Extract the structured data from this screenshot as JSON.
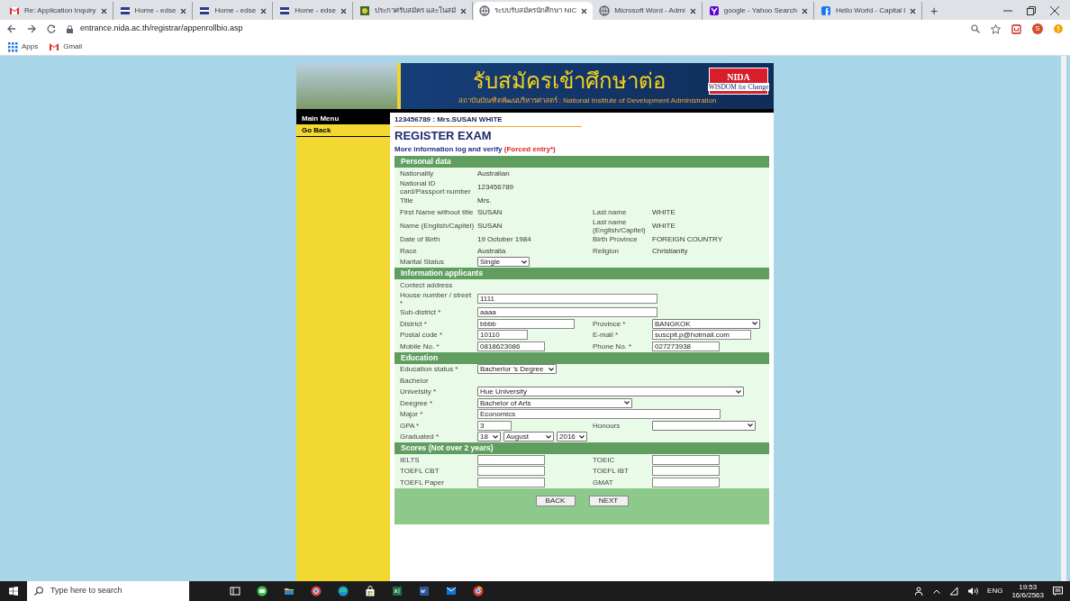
{
  "browser": {
    "tabs": [
      {
        "title": "Re: Application Inquiry",
        "kind": "mail",
        "selected": false
      },
      {
        "title": "Home - edse",
        "kind": "flag",
        "selected": false
      },
      {
        "title": "Home - edse",
        "kind": "flag",
        "selected": false
      },
      {
        "title": "Home - edse",
        "kind": "flag",
        "selected": false
      },
      {
        "title": "ประกาศรับสมัคร และในสมั",
        "kind": "photo",
        "selected": false
      },
      {
        "title": "ระบบรับสมัครนักศึกษา NIC",
        "kind": "globe",
        "selected": true
      },
      {
        "title": "Microsoft Word - Admi",
        "kind": "globe",
        "selected": false
      },
      {
        "title": "google - Yahoo Search",
        "kind": "yahoo",
        "selected": false
      },
      {
        "title": "Hello World - Capital l",
        "kind": "facebook",
        "selected": false
      }
    ],
    "new_tab": "+",
    "url": "entrance.nida.ac.th/registrar/appenrollbio.asp",
    "profile_initial": "S",
    "bookmarks": [
      {
        "label": "Apps",
        "kind": "grid"
      },
      {
        "label": "Gmail",
        "kind": "mail"
      }
    ]
  },
  "page": {
    "banner": {
      "title": "รับสมัครเข้าศึกษาต่อ",
      "subtitle": "สถาบันบัณฑิตพัฒนบริหารศาสตร์ : National Institute of Development Administration",
      "logo": "NIDA",
      "logo_tagline": "WISDOM for Change"
    },
    "sidebar": [
      {
        "label": "Main Menu",
        "kind": "heading"
      },
      {
        "label": "Go Back",
        "kind": "link"
      }
    ],
    "user_line": "123456789 : Mrs.SUSAN WHITE",
    "heading": "REGISTER EXAM",
    "intro": {
      "text": "More information log and verify",
      "note": "(Forced entry*)"
    },
    "sections": [
      {
        "title": "Personal data",
        "rows": [
          [
            {
              "label": "Nationality",
              "kind": "text",
              "value": "Australian"
            }
          ],
          [
            {
              "label": "National ID card/Passport number",
              "kind": "text",
              "value": "123456789"
            }
          ],
          [
            {
              "label": "Title",
              "kind": "text",
              "value": "Mrs."
            }
          ],
          [
            {
              "label": "First Name without title",
              "kind": "text",
              "value": "SUSAN"
            },
            {
              "label": "Last name",
              "kind": "text",
              "value": "WHITE"
            }
          ],
          [
            {
              "label": "Name (English/Capitel)",
              "kind": "text",
              "value": "SUSAN"
            },
            {
              "label": "Last name (English/Capitel)",
              "kind": "text",
              "value": "WHITE"
            }
          ],
          [
            {
              "label": "Date of Birth",
              "kind": "text",
              "value": "19 October 1984"
            },
            {
              "label": "Birth Province",
              "kind": "text",
              "value": "FOREIGN COUNTRY"
            }
          ],
          [
            {
              "label": "Race",
              "kind": "text",
              "value": "Australia"
            },
            {
              "label": "Religion",
              "kind": "text",
              "value": "Christianity"
            }
          ],
          [
            {
              "label": "Marital Status",
              "kind": "select",
              "value": "Single"
            }
          ]
        ]
      },
      {
        "title": "Information applicants",
        "rows": [
          [
            {
              "label": "Contect address",
              "kind": "note"
            }
          ],
          [
            {
              "label": "House number / street *",
              "kind": "input",
              "value": "1111"
            }
          ],
          [
            {
              "label": "Sub-district *",
              "kind": "input",
              "value": "aaaa"
            }
          ],
          [
            {
              "label": "District *",
              "kind": "input",
              "value": "bbbb"
            },
            {
              "label": "Province *",
              "kind": "select",
              "value": "BANGKOK"
            }
          ],
          [
            {
              "label": "Postal code *",
              "kind": "input",
              "value": "10110"
            },
            {
              "label": "E-mail *",
              "kind": "input",
              "value": "suscpit.p@hotmail.com"
            }
          ],
          [
            {
              "label": "Mobile No. *",
              "kind": "input",
              "value": "0818623086"
            },
            {
              "label": "Phone No. *",
              "kind": "input",
              "value": "027273938"
            }
          ]
        ]
      },
      {
        "title": "Education",
        "rows": [
          [
            {
              "label": "Education status *",
              "kind": "select",
              "value": "Bacherlor 's Degree"
            }
          ],
          [
            {
              "label": "Bachelor",
              "kind": "note"
            }
          ],
          [
            {
              "label": "Univetsity *",
              "kind": "select",
              "value": "Hue University"
            }
          ],
          [
            {
              "label": "Deegree *",
              "kind": "select",
              "value": "Bachelor of Arts"
            }
          ],
          [
            {
              "label": "Major *",
              "kind": "input",
              "value": "Economics"
            }
          ],
          [
            {
              "label": "GPA *",
              "kind": "input",
              "value": "3"
            },
            {
              "label": "Honours",
              "kind": "select"
            }
          ],
          [
            {
              "label": "Graduated *",
              "kind": "dates",
              "values": [
                "18",
                "August",
                "2016"
              ]
            }
          ]
        ]
      },
      {
        "title": "Scores (Not over 2 years)",
        "rows": [
          [
            {
              "label": "IELTS",
              "kind": "input"
            },
            {
              "label": "TOEIC",
              "kind": "input"
            }
          ],
          [
            {
              "label": "TOEFL CBT",
              "kind": "input"
            },
            {
              "label": "TOEFL IBT",
              "kind": "input"
            }
          ],
          [
            {
              "label": "TOEFL Paper",
              "kind": "input"
            },
            {
              "label": "GMAT",
              "kind": "input"
            }
          ]
        ]
      }
    ],
    "buttons": [
      "BACK",
      "NEXT"
    ]
  },
  "taskbar": {
    "search_placeholder": "Type here to search",
    "language": "ENG",
    "time": "19:53",
    "date": "16/6/2563"
  }
}
